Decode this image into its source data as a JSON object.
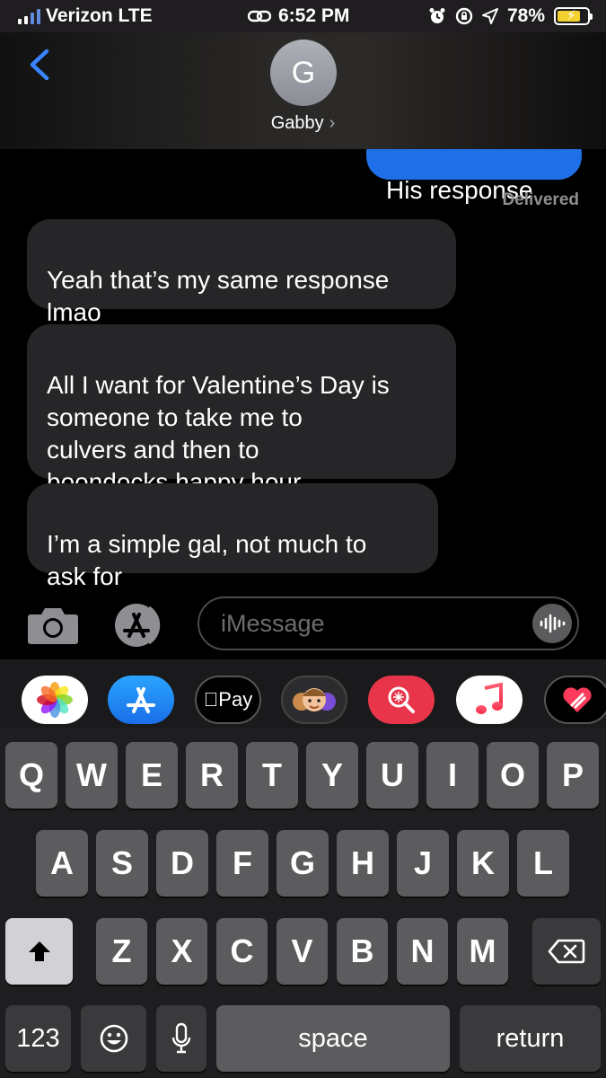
{
  "status_bar": {
    "carrier": "Verizon LTE",
    "time": "6:52 PM",
    "battery": "78%",
    "battery_level": 0.78
  },
  "header": {
    "avatar_initial": "G",
    "contact_name": "Gabby",
    "chevron": "›"
  },
  "messages": [
    {
      "from": "me",
      "text": "His response"
    },
    {
      "from": "them",
      "text": "Yeah that’s my same response\nlmao"
    },
    {
      "from": "them",
      "text": "All I want for Valentine’s Day is\nsomeone to take me to\nculvers and then to\nboondocks happy hour"
    },
    {
      "from": "them",
      "text": "I’m a simple gal, not much to\nask for"
    }
  ],
  "delivered_label": "Delivered",
  "compose": {
    "placeholder": "iMessage"
  },
  "app_drawer": {
    "apple_pay_label": "Pay",
    "apps": [
      "photos-app",
      "app-store-app",
      "apple-pay-app",
      "memoji-app",
      "search-images-app",
      "music-app",
      "digital-touch-app"
    ]
  },
  "keyboard": {
    "row1": [
      "Q",
      "W",
      "E",
      "R",
      "T",
      "Y",
      "U",
      "I",
      "O",
      "P"
    ],
    "row2": [
      "A",
      "S",
      "D",
      "F",
      "G",
      "H",
      "J",
      "K",
      "L"
    ],
    "row3": [
      "Z",
      "X",
      "C",
      "V",
      "B",
      "N",
      "M"
    ],
    "numbers_label": "123",
    "space_label": "space",
    "return_label": "return"
  },
  "colors": {
    "sent_bubble": "#1f70e8",
    "received_bubble": "#262628",
    "accent": "#3a85ff"
  }
}
